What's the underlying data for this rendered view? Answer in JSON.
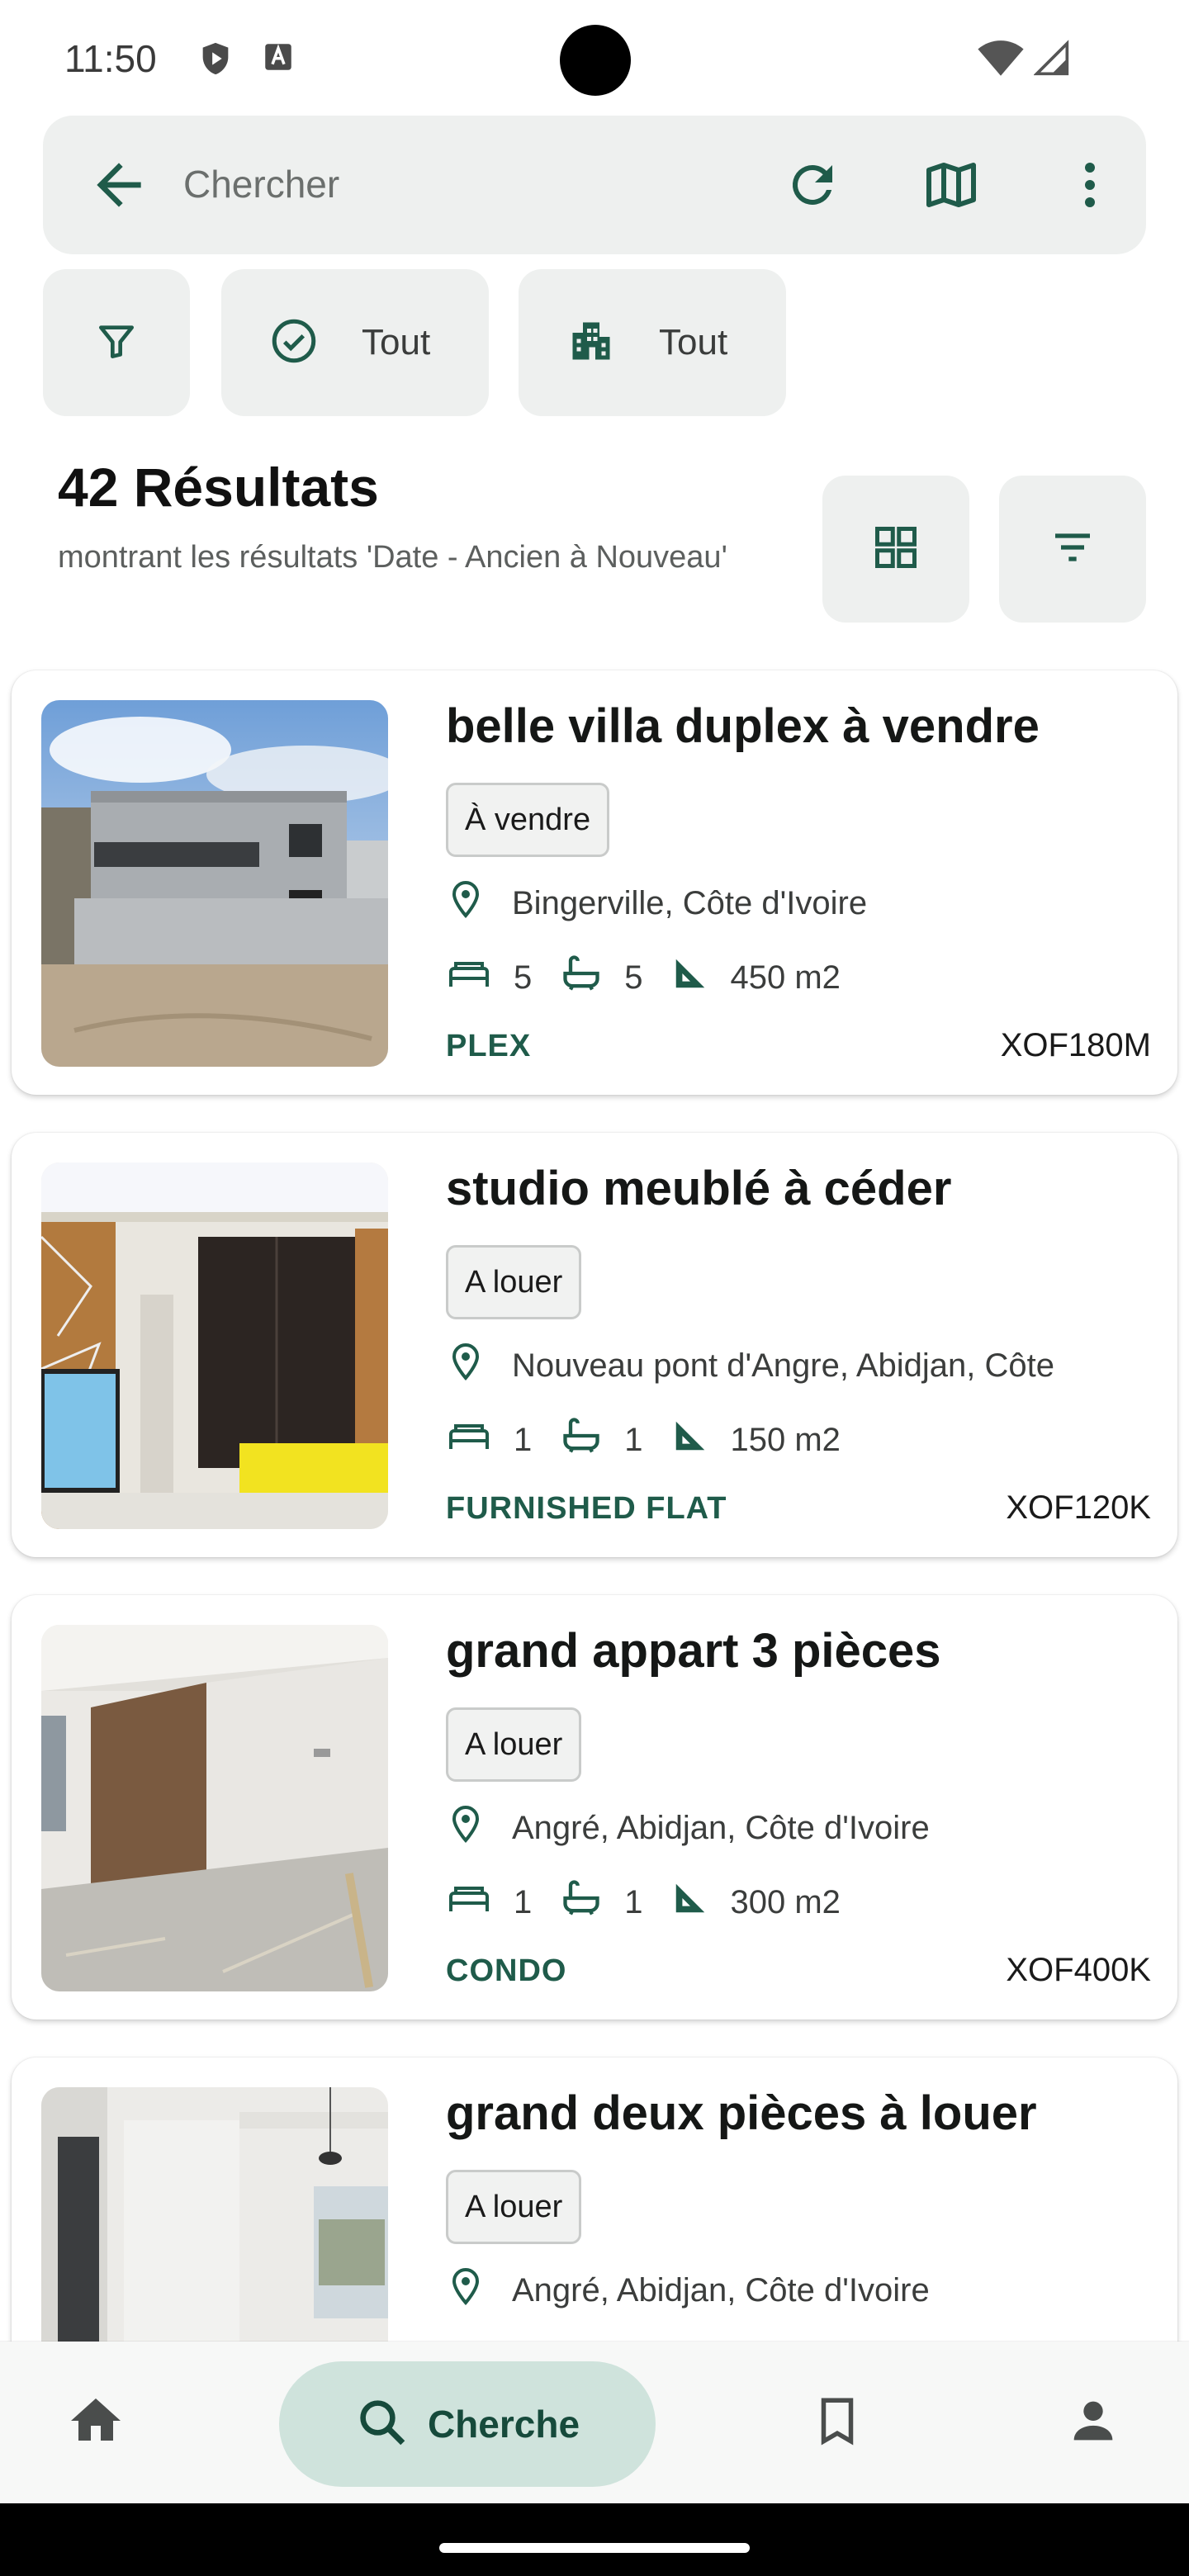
{
  "status": {
    "time": "11:50"
  },
  "search": {
    "placeholder": "Chercher"
  },
  "filters": {
    "status_label": "Tout",
    "type_label": "Tout"
  },
  "results": {
    "title": "42 Résultats",
    "subtitle": "montrant les résultats 'Date - Ancien à Nouveau'"
  },
  "listings": [
    {
      "title": "belle villa duplex à vendre",
      "badge": "À vendre",
      "location": "Bingerville, Côte d'Ivoire",
      "beds": "5",
      "baths": "5",
      "area": "450 m2",
      "type": "PLEX",
      "price": "XOF180M"
    },
    {
      "title": "studio meublé à céder",
      "badge": "A louer",
      "location": "Nouveau pont d'Angre, Abidjan, Côte",
      "beds": "1",
      "baths": "1",
      "area": "150 m2",
      "type": "FURNISHED FLAT",
      "price": "XOF120K"
    },
    {
      "title": "grand appart 3 pièces",
      "badge": "A louer",
      "location": "Angré, Abidjan, Côte d'Ivoire",
      "beds": "1",
      "baths": "1",
      "area": "300 m2",
      "type": "CONDO",
      "price": "XOF400K"
    },
    {
      "title": "grand deux pièces à louer",
      "badge": "A louer",
      "location": "Angré, Abidjan, Côte d'Ivoire"
    }
  ],
  "nav": {
    "search_label": "Cherche"
  },
  "icons": [
    "back-arrow-icon",
    "refresh-icon",
    "map-icon",
    "more-vert-icon",
    "filter-icon",
    "check-circle-icon",
    "buildings-icon",
    "grid-view-icon",
    "sort-icon",
    "location-pin-icon",
    "bed-icon",
    "bath-icon",
    "area-icon",
    "home-icon",
    "search-icon",
    "bookmark-icon",
    "person-icon"
  ],
  "colors": {
    "accent": "#1f5b4a",
    "chip_bg": "#eef0ef",
    "active_nav_bg": "#cfe3dc"
  }
}
